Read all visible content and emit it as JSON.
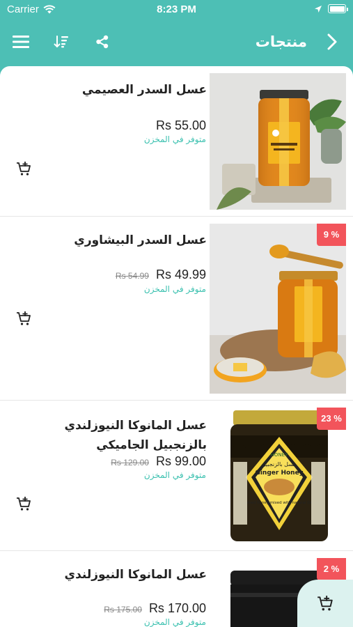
{
  "status_bar": {
    "carrier": "Carrier",
    "time": "8:23 PM"
  },
  "nav": {
    "title": "منتجات"
  },
  "products": [
    {
      "name": "عسل السدر العصيمي",
      "price": "Rs 55.00",
      "old_price": "",
      "stock": "متوفر في المخزن",
      "badge": ""
    },
    {
      "name": "عسل السدر البيشاوري",
      "price": "Rs 49.99",
      "old_price": "Rs 54.99",
      "stock": "متوفر في المخزن",
      "badge": "9 %"
    },
    {
      "name": "عسل المانوكا النيوزلندي بالزنجبيل الجاميكي",
      "price": "Rs 99.00",
      "old_price": "Rs 129.00",
      "stock": "متوفر في المخزن",
      "badge": "23 %",
      "image_text": {
        "brand": "HONEY",
        "name_ar": "عسل بالزنجبيل",
        "name_en": "Ginger Honey",
        "desc": "Creamed honey mixed with natural Ginger"
      }
    },
    {
      "name": "عسل المانوكا النيوزلندي",
      "price": "Rs 170.00",
      "old_price": "Rs 175.00",
      "stock": "متوفر في المخزن",
      "badge": "2 %"
    }
  ],
  "colors": {
    "teal": "#4dbfb5",
    "badge_red": "#f2545b",
    "stock_green": "#3cc1b0"
  }
}
